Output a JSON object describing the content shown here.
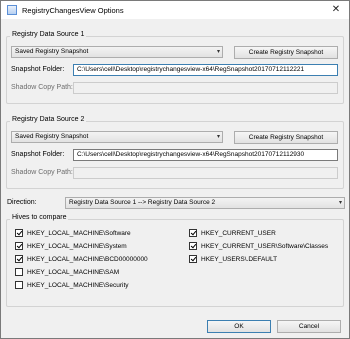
{
  "window": {
    "title": "RegistryChangesView Options",
    "close_glyph": "✕"
  },
  "source1": {
    "group_label": "Registry Data Source 1",
    "source_type": "Saved Registry Snapshot",
    "create_button": "Create Registry Snapshot",
    "snapshot_folder_label": "Snapshot Folder:",
    "snapshot_folder_value": "C:\\Users\\cell\\Desktop\\registrychangesview-x64\\RegSnapshot20170712112221",
    "shadow_copy_label": "Shadow Copy Path:",
    "shadow_copy_value": ""
  },
  "source2": {
    "group_label": "Registry Data Source 2",
    "source_type": "Saved Registry Snapshot",
    "create_button": "Create Registry Snapshot",
    "snapshot_folder_label": "Snapshot Folder:",
    "snapshot_folder_value": "C:\\Users\\cell\\Desktop\\registrychangesview-x64\\RegSnapshot20170712112930",
    "shadow_copy_label": "Shadow Copy Path:",
    "shadow_copy_value": ""
  },
  "direction": {
    "label": "Direction:",
    "value": "Registry Data Source 1 --> Registry Data Source 2"
  },
  "hives": {
    "label": "Hives to compare",
    "left": [
      {
        "label": "HKEY_LOCAL_MACHINE\\Software",
        "checked": true
      },
      {
        "label": "HKEY_LOCAL_MACHINE\\System",
        "checked": true
      },
      {
        "label": "HKEY_LOCAL_MACHINE\\BCD00000000",
        "checked": true
      },
      {
        "label": "HKEY_LOCAL_MACHINE\\SAM",
        "checked": false
      },
      {
        "label": "HKEY_LOCAL_MACHINE\\Security",
        "checked": false
      }
    ],
    "right": [
      {
        "label": "HKEY_CURRENT_USER",
        "checked": true
      },
      {
        "label": "HKEY_CURRENT_USER\\Software\\Classes",
        "checked": true
      },
      {
        "label": "HKEY_USERS\\.DEFAULT",
        "checked": true
      }
    ]
  },
  "buttons": {
    "ok": "OK",
    "cancel": "Cancel"
  },
  "icons": {
    "combo_arrow": "▾",
    "app": "app-icon"
  }
}
